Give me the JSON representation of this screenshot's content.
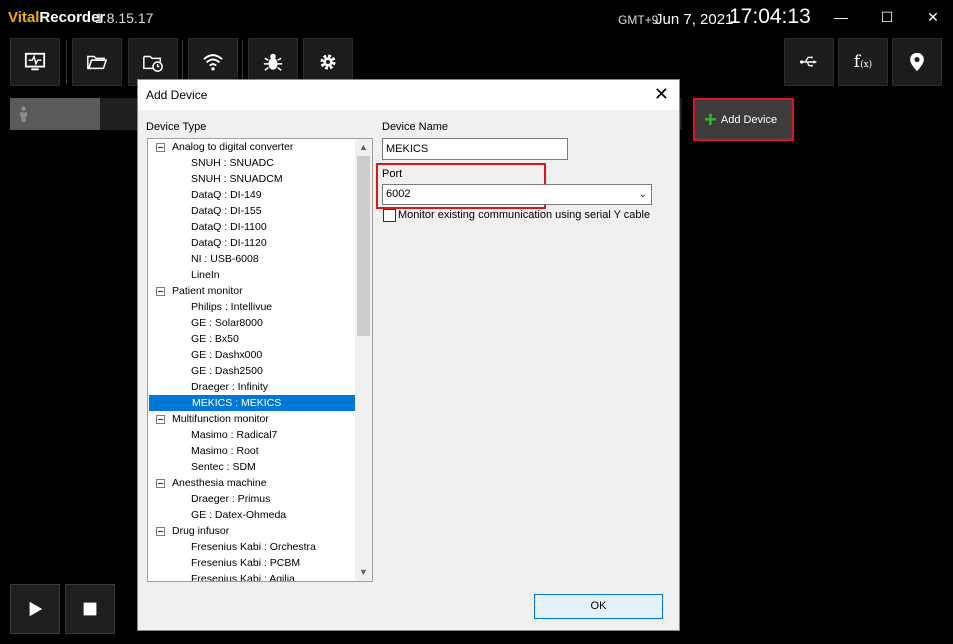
{
  "app": {
    "brand_first": "Vital",
    "brand_second": "Recorder",
    "version": "1.8.15.17",
    "timezone": "GMT+9",
    "date": "Jun 7, 2021",
    "time": "17:04:13"
  },
  "window_controls": {
    "minimize": "—",
    "maximize": "☐",
    "close": "✕"
  },
  "toolbar": {
    "left_icons": [
      "monitor-icon",
      "folder-open-icon",
      "folder-clock-icon",
      "wifi-icon",
      "bug-icon",
      "gear-icon"
    ],
    "right_icons": [
      "usb-icon",
      "function-icon",
      "location-pin-icon"
    ],
    "function_label": "f",
    "function_sub": "(x)"
  },
  "main": {
    "add_device_label": "Add Device",
    "add_device_plus": "+"
  },
  "dialog": {
    "title": "Add Device",
    "device_type_label": "Device Type",
    "device_name_label": "Device Name",
    "device_name_value": "MEKICS",
    "port_label": "Port",
    "port_value": "6002",
    "monitor_checkbox_label": "Monitor existing communication using serial Y cable",
    "ok_label": "OK"
  },
  "tree": [
    {
      "text": "Analog to digital converter",
      "type": "cat"
    },
    {
      "text": "SNUH : SNUADC",
      "type": "item"
    },
    {
      "text": "SNUH : SNUADCM",
      "type": "item"
    },
    {
      "text": "DataQ : DI-149",
      "type": "item"
    },
    {
      "text": "DataQ : DI-155",
      "type": "item"
    },
    {
      "text": "DataQ : DI-1100",
      "type": "item"
    },
    {
      "text": "DataQ : DI-1120",
      "type": "item"
    },
    {
      "text": "NI : USB-6008",
      "type": "item"
    },
    {
      "text": "LineIn",
      "type": "item"
    },
    {
      "text": "Patient monitor",
      "type": "cat"
    },
    {
      "text": "Philips : Intellivue",
      "type": "item"
    },
    {
      "text": "GE : Solar8000",
      "type": "item"
    },
    {
      "text": "GE : Bx50",
      "type": "item"
    },
    {
      "text": "GE : Dashx000",
      "type": "item"
    },
    {
      "text": "GE : Dash2500",
      "type": "item"
    },
    {
      "text": "Draeger : Infinity",
      "type": "item"
    },
    {
      "text": "MEKICS : MEKICS",
      "type": "item",
      "selected": true
    },
    {
      "text": "Multifunction monitor",
      "type": "cat"
    },
    {
      "text": "Masimo : Radical7",
      "type": "item"
    },
    {
      "text": "Masimo : Root",
      "type": "item"
    },
    {
      "text": "Sentec : SDM",
      "type": "item"
    },
    {
      "text": "Anesthesia machine",
      "type": "cat"
    },
    {
      "text": "Draeger : Primus",
      "type": "item"
    },
    {
      "text": "GE : Datex-Ohmeda",
      "type": "item"
    },
    {
      "text": "Drug infusor",
      "type": "cat"
    },
    {
      "text": "Fresenius Kabi : Orchestra",
      "type": "item"
    },
    {
      "text": "Fresenius Kabi : PCBM",
      "type": "item"
    },
    {
      "text": "Fresenius Kabi : Agilia",
      "type": "item"
    }
  ],
  "colors": {
    "accent_red": "#e0141e",
    "selection_blue": "#0078d7",
    "plus_green": "#34b42a",
    "brand_yellow": "#e8b400"
  }
}
